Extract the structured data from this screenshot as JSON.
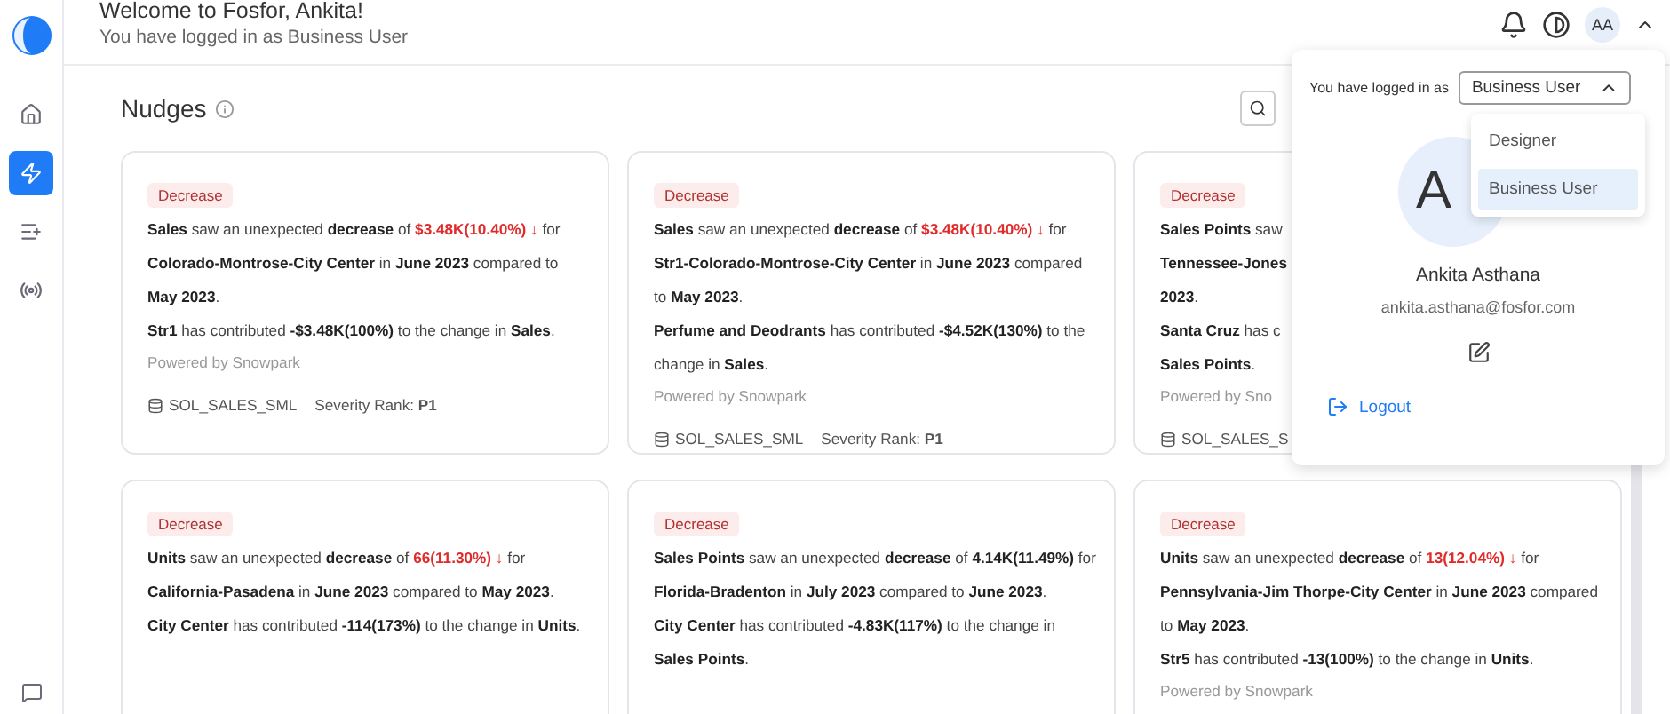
{
  "header": {
    "title": "Welcome to Fosfor, Ankita!",
    "subtitle": "You have logged in as Business User",
    "avatar_initials": "AA"
  },
  "sidebar": {
    "items": [
      {
        "kind": "home",
        "selected": false
      },
      {
        "kind": "nudges",
        "selected": true
      },
      {
        "kind": "list",
        "selected": false
      },
      {
        "kind": "signal",
        "selected": false
      }
    ]
  },
  "section": {
    "title": "Nudges"
  },
  "cards": [
    {
      "kind": "full",
      "badge": "Decrease",
      "statement": {
        "before": "**Sales** saw an unexpected **decrease** of",
        "value": "$3.48K(10.40%) ↓",
        "highlight": true,
        "after": "for **Colorado-Montrose-City Center** in **June 2023** compared to **May 2023**."
      },
      "contribution": "**Str1** has contributed **-$3.48K(100%)** to the change in **Sales**.",
      "powered_by": "Powered by Snowpark",
      "source": "SOL_SALES_SML",
      "severity": "Severity Rank: **P1**"
    },
    {
      "kind": "full",
      "badge": "Decrease",
      "statement": {
        "before": "**Sales** saw an unexpected **decrease** of",
        "value": "$3.48K(10.40%) ↓",
        "highlight": true,
        "after": "for **Str1-Colorado-Montrose-City Center** in **June 2023** compared to **May 2023**."
      },
      "contribution": "**Perfume and Deodrants** has contributed **-$4.52K(130%)** to the change in **Sales**.",
      "powered_by": "Powered by Snowpark",
      "source": "SOL_SALES_SML",
      "severity": "Severity Rank: **P1**"
    },
    {
      "kind": "clipped",
      "badge": "Decrease",
      "lines": [
        [
          "**Sales Points** saw",
          "**Tennessee-Jones**",
          "**2023**."
        ],
        [
          "**Santa Cruz** has c",
          "**Sales Points**."
        ]
      ],
      "powered_by": "Powered by Sno",
      "source": "SOL_SALES_S"
    },
    {
      "kind": "full",
      "badge": "Decrease",
      "statement": {
        "before": "**Units** saw an unexpected **decrease** of",
        "value": "66(11.30%) ↓",
        "highlight": true,
        "after": "for **California-Pasadena** in **June 2023** compared to **May 2023**."
      },
      "contribution": "**City Center** has contributed **-114(173%)** to the change in **Units**."
    },
    {
      "kind": "full",
      "badge": "Decrease",
      "statement": {
        "before": "**Sales Points** saw an unexpected **decrease** of",
        "value": "4.14K(11.49%)",
        "highlight": false,
        "after": "for **Florida-Bradenton** in **July 2023** compared to **June 2023**."
      },
      "contribution": "**City Center** has contributed **-4.83K(117%)** to the change in **Sales Points**."
    },
    {
      "kind": "full",
      "badge": "Decrease",
      "statement": {
        "before": "**Units** saw an unexpected **decrease** of",
        "value": "13(12.04%) ↓",
        "highlight": true,
        "after": "for **Pennsylvania-Jim Thorpe-City Center** in **June 2023** compared to **May 2023**."
      },
      "contribution": "**Str5** has contributed **-13(100%)** to the change in **Units**.",
      "powered_by": "Powered by Snowpark"
    }
  ],
  "profile": {
    "role_label": "You have logged in as",
    "role_value": "Business User",
    "options": [
      {
        "label": "Designer",
        "selected": false
      },
      {
        "label": "Business User",
        "selected": true
      }
    ],
    "avatar_initial": "A",
    "name": "Ankita Asthana",
    "email": "ankita.asthana@fosfor.com",
    "logout": "Logout"
  }
}
